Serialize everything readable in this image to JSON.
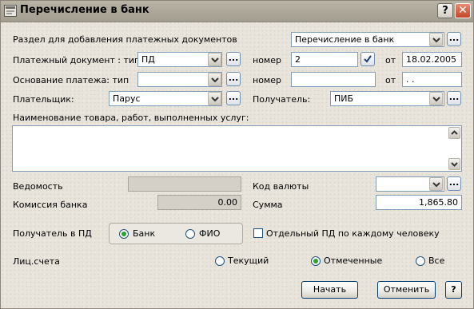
{
  "window": {
    "title": "Перечисление в банк",
    "help_glyph": "?",
    "close_glyph": "✕"
  },
  "section": {
    "label": "Раздел для добавления платежных документов",
    "value": "Перечисление в банк"
  },
  "payment_doc": {
    "type_label": "Платежный документ : тип",
    "type_value": "ПД",
    "number_label": "номер",
    "number_value": "2",
    "date_label": "от",
    "date_value": "18.02.2005"
  },
  "basis": {
    "type_label": "Основание платежа: тип",
    "type_value": "",
    "number_label": "номер",
    "number_value": "",
    "date_label": "от",
    "date_value": " .  ."
  },
  "payer": {
    "label": "Плательщик:",
    "value": "Парус"
  },
  "recipient": {
    "label": "Получатель:",
    "value": "ПИБ"
  },
  "goods": {
    "label": "Наименование товара, работ, выполненных услуг:",
    "value": ""
  },
  "statement": {
    "label": "Ведомость",
    "value": ""
  },
  "currency": {
    "label": "Код валюты",
    "value": ""
  },
  "commission": {
    "label": "Комиссия банка",
    "value": "0.00"
  },
  "sum": {
    "label": "Сумма",
    "value": "1,865.80"
  },
  "pd_recipient": {
    "label": "Получатель в ПД",
    "options": [
      "Банк",
      "ФИО"
    ],
    "selected": "Банк"
  },
  "separate_pd": {
    "label": "Отдельный ПД по каждому человеку",
    "checked": false
  },
  "accounts": {
    "label": "Лиц.счета",
    "options": [
      "Текущий",
      "Отмеченные",
      "Все"
    ],
    "selected": "Отмеченные"
  },
  "buttons": {
    "start": "Начать",
    "cancel": "Отменить",
    "help": "?"
  },
  "icons": {
    "ellipsis": "...",
    "title_icon": "window-app-icon"
  },
  "colors": {
    "title_bar": "#a8a296",
    "close_button": "#d0563a",
    "field_border": "#7f9db9",
    "radio_selected": "#2aa32a"
  }
}
